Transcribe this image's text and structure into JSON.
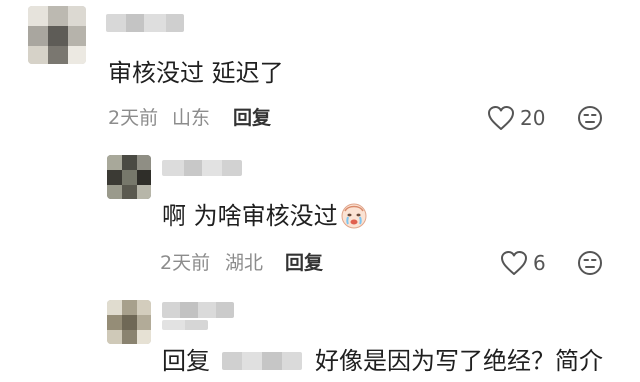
{
  "comments": [
    {
      "text": "审核没过 延迟了",
      "time": "2天前",
      "location": "山东",
      "reply_label": "回复",
      "like_count": "20"
    },
    {
      "text": "啊 为啥审核没过",
      "time": "2天前",
      "location": "湖北",
      "reply_label": "回复",
      "like_count": "6"
    },
    {
      "reply_prefix": "回复",
      "text": "好像是因为写了绝经？简介"
    }
  ],
  "icons": {
    "like": "heart-outline-icon",
    "dislike": "meh-face-icon",
    "emoji": "crying-baby-emoji"
  },
  "colors": {
    "meta_text": "#8c8c8c",
    "body_text": "#1f1f1f",
    "icon_stroke": "#555555"
  }
}
